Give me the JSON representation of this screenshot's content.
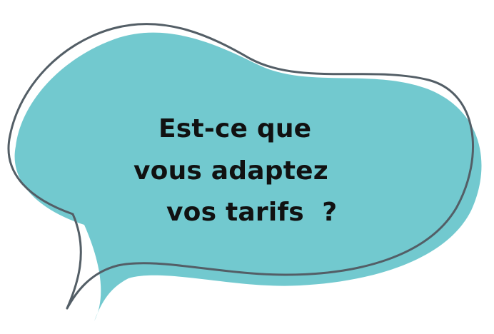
{
  "speech_bubble": {
    "lines": [
      "Est-ce que",
      "vous adaptez",
      "vos tarifs  ?"
    ],
    "fill_color": "#72c9cf",
    "outline_color": "#535e66",
    "text_color": "#111111"
  }
}
